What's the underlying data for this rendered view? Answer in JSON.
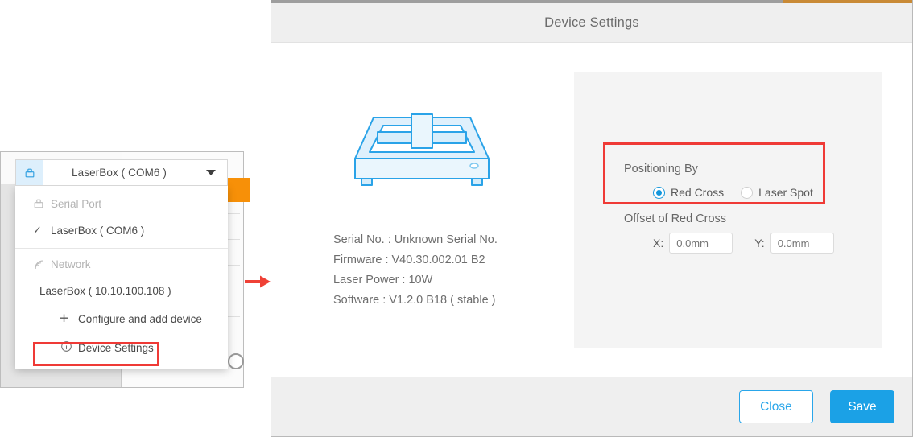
{
  "background_panel": {
    "name": "application-window-behind"
  },
  "device_select": {
    "icon": "serial-port-icon",
    "label": "LaserBox ( COM6 )",
    "caret": "chevron-down-icon"
  },
  "device_menu": {
    "groups": [
      {
        "header": {
          "icon": "serial-port-icon",
          "label": "Serial Port"
        },
        "items": [
          {
            "label": "LaserBox ( COM6 )",
            "checked": true,
            "check_glyph": "✓"
          }
        ]
      },
      {
        "header": {
          "icon": "wifi-network-icon",
          "label": "Network"
        },
        "items": [
          {
            "label": "LaserBox ( 10.10.100.108 )",
            "checked": false,
            "check_glyph": ""
          }
        ]
      }
    ],
    "actions": [
      {
        "icon": "plus-icon",
        "glyph": "+",
        "label": "Configure and add device",
        "highlighted": false
      },
      {
        "icon": "info-circle-icon",
        "glyph": "ⓘ",
        "label": "Device Settings",
        "highlighted": true
      }
    ]
  },
  "flow_arrow": {
    "name": "red-flow-arrow",
    "color": "#ef4136"
  },
  "dialog": {
    "title": "Device Settings",
    "accent_color": "#c98a36",
    "illustration": "laser-cutter-illustration",
    "info": [
      "Serial No. : Unknown Serial No.",
      "Firmware : V40.30.002.01 B2",
      "Laser Power : 10W",
      "Software : V1.2.0 B18 ( stable )"
    ],
    "positioning": {
      "section_label": "Positioning By",
      "options": [
        {
          "label": "Red Cross",
          "selected": true
        },
        {
          "label": "Laser Spot",
          "selected": false
        }
      ],
      "offset_label": "Offset of Red Cross",
      "offset_x": {
        "label": "X:",
        "value": "0.0mm",
        "placeholder": "0.0mm"
      },
      "offset_y": {
        "label": "Y:",
        "value": "0.0mm",
        "placeholder": "0.0mm"
      },
      "highlight_color": "#ef3a36"
    },
    "footer": {
      "close_label": "Close",
      "save_label": "Save",
      "close_color": "#29a6ea",
      "save_color": "#1ba1e6"
    }
  }
}
